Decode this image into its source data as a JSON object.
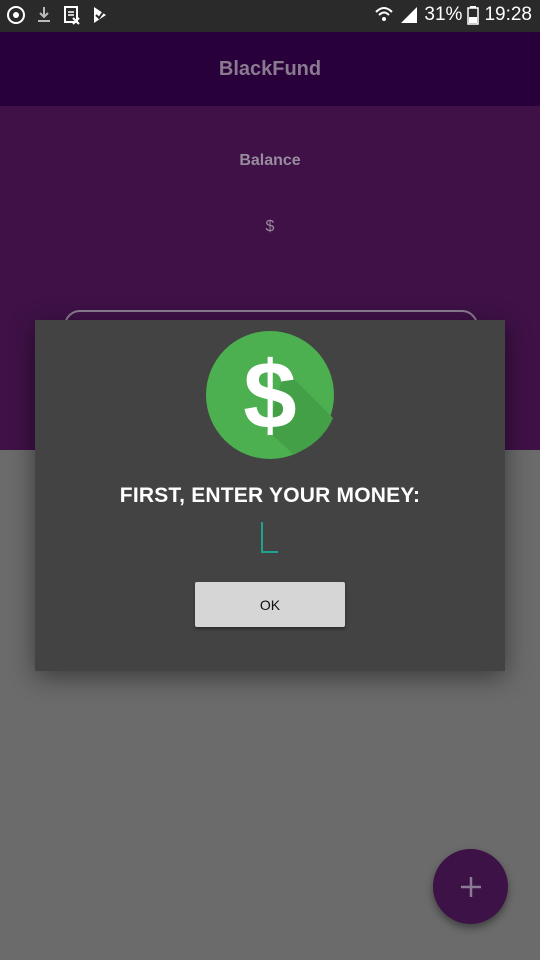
{
  "status_bar": {
    "battery_percent": "31%",
    "time": "19:28",
    "left_icons": [
      "eye-icon",
      "download-icon",
      "sheet-icon",
      "flag-check-icon"
    ],
    "right_icons": [
      "wifi-icon",
      "signal-icon",
      "battery-icon"
    ]
  },
  "app": {
    "title": "BlackFund",
    "balance_label": "Balance",
    "balance_value": "$",
    "fab_icon": "plus-icon"
  },
  "dialog": {
    "icon": "dollar-icon",
    "message": "FIRST, ENTER YOUR MONEY:",
    "input_value": "",
    "ok_label": "OK"
  },
  "colors": {
    "app_bar": "#28003a",
    "balance_panel": "#3f1147",
    "dialog_bg": "#434343",
    "dollar_green": "#4caf50",
    "accent_teal": "#1fa38f"
  }
}
